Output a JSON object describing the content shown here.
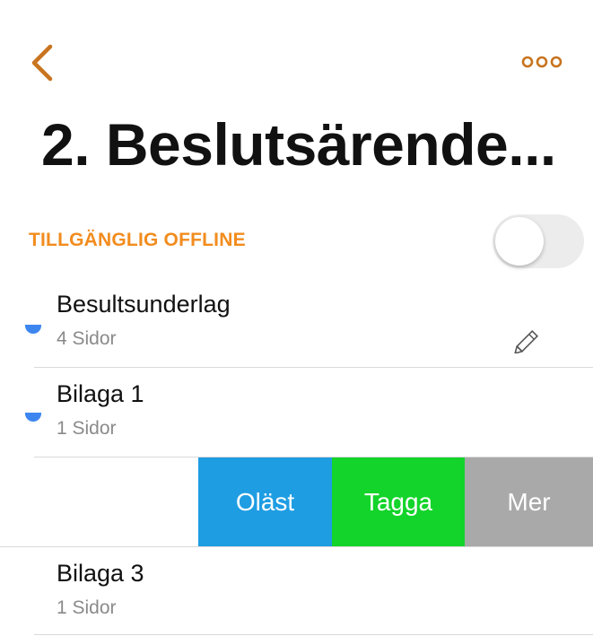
{
  "nav": {
    "back_icon": "chevron-left-icon",
    "more_icon": "more-dots-icon",
    "accent_color": "#c8741f"
  },
  "title": "2. Beslutsärende...",
  "offline": {
    "label": "TILLGÄNGLIG OFFLINE",
    "enabled": false,
    "label_color": "#f28c1e"
  },
  "documents": [
    {
      "title": "Besultsunderlag",
      "pages": "4 Sidor",
      "unread": true
    },
    {
      "title": "Bilaga 1",
      "pages": "1 Sidor",
      "unread": true
    },
    {
      "title": "Bilaga 3",
      "pages": "1 Sidor",
      "unread": false
    }
  ],
  "swipe_actions": [
    {
      "label": "Oläst",
      "color": "#1e9de3"
    },
    {
      "label": "Tagga",
      "color": "#13d42a"
    },
    {
      "label": "Mer",
      "color": "#a9a9a9"
    }
  ],
  "unread_indicator_color": "#3d86f0"
}
